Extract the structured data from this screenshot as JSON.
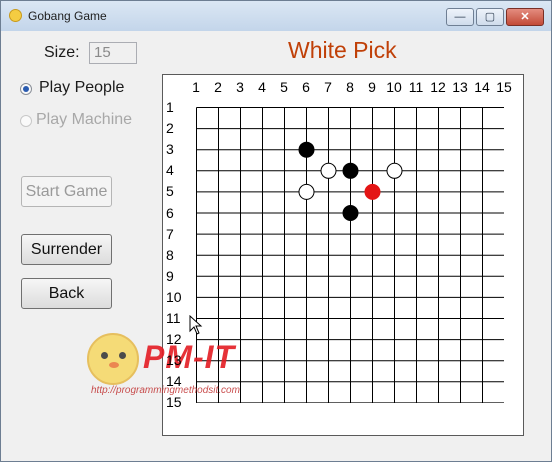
{
  "window": {
    "title": "Gobang Game",
    "min_glyph": "—",
    "max_glyph": "▢",
    "close_glyph": "✕"
  },
  "controls": {
    "size_label": "Size:",
    "size_value": "15",
    "play_people_label": "Play People",
    "play_machine_label": "Play Machine",
    "start_game_label": "Start Game",
    "surrender_label": "Surrender",
    "back_label": "Back"
  },
  "status_heading": "White Pick",
  "board": {
    "size": 15,
    "column_labels": [
      "1",
      "2",
      "3",
      "4",
      "5",
      "6",
      "7",
      "8",
      "9",
      "10",
      "11",
      "12",
      "13",
      "14",
      "15"
    ],
    "row_labels": [
      "1",
      "2",
      "3",
      "4",
      "5",
      "6",
      "7",
      "8",
      "9",
      "10",
      "11",
      "12",
      "13",
      "14",
      "15"
    ],
    "stones": [
      {
        "col": 6,
        "row": 3,
        "color": "black"
      },
      {
        "col": 8,
        "row": 4,
        "color": "black"
      },
      {
        "col": 8,
        "row": 6,
        "color": "black"
      },
      {
        "col": 7,
        "row": 4,
        "color": "white"
      },
      {
        "col": 10,
        "row": 4,
        "color": "white"
      },
      {
        "col": 6,
        "row": 5,
        "color": "white"
      },
      {
        "col": 9,
        "row": 5,
        "color": "last-move"
      }
    ],
    "colors": {
      "black": "#000000",
      "white": "#ffffff",
      "last-move": "#e41515",
      "heading": "#c04008"
    }
  },
  "watermark": {
    "logo_text": "PM-IT",
    "url": "http://programmingmethodsit.com"
  }
}
